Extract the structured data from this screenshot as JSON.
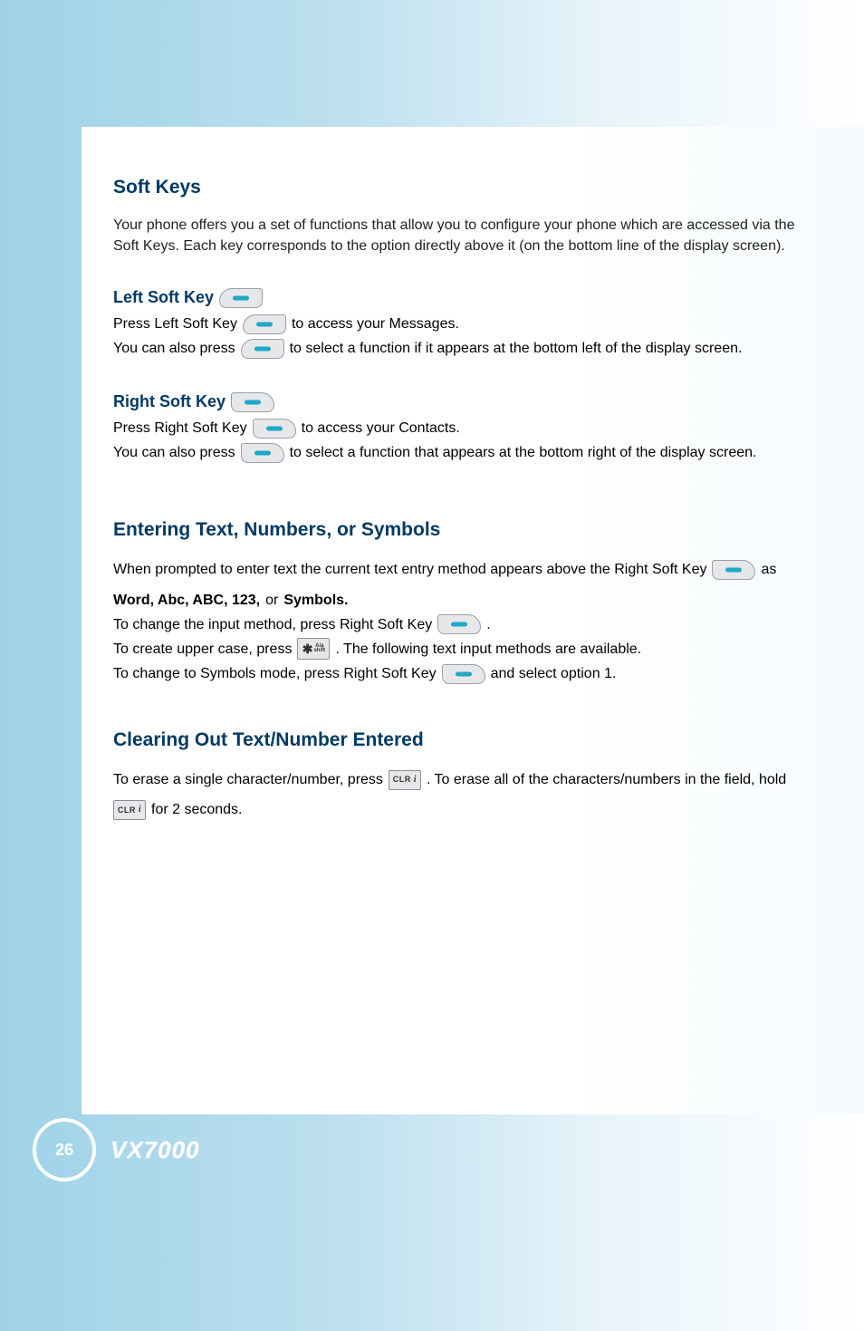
{
  "softkeys": {
    "heading": "Soft Keys",
    "para1": "Your phone offers you a set of functions that allow you to configure your phone which are accessed via the Soft Keys. Each key corresponds to the option directly above it (on the bottom line of the display screen).",
    "left": {
      "title": "Left Soft Key",
      "line1_a": "Press Left Soft Key",
      "line1_b": "to access your Messages.",
      "line2_a": "You can also press",
      "line2_b": "to select a function if it appears at the bottom left of the display screen."
    },
    "right": {
      "title": "Right Soft Key",
      "line1_a": "Press Right Soft Key",
      "line1_b": "to access your Contacts.",
      "line2_a": "You can also press",
      "line2_b": "to select a function that appears at the bottom right of the display screen."
    }
  },
  "entering": {
    "heading": "Entering Text, Numbers, or Symbols",
    "line1": "When prompted to enter text the current text entry method appears above the Right Soft Key",
    "line1_b": "as",
    "modes": "Word, Abc, ABC, 123,",
    "or": "or",
    "symbols": "Symbols.",
    "line2_a": "To change the input method, press Right Soft Key",
    "line2_b": ".",
    "line3_a": "To create upper case, press",
    "line3_b": ". The following text input methods are available.",
    "line4_a": "To change to Symbols mode, press Right Soft Key",
    "line4_b": "and select option 1."
  },
  "clearing": {
    "heading": "Clearing Out Text/Number Entered",
    "line1_a": "To erase a single character/number, press",
    "line1_b": ". To erase all of the characters/numbers in the field, hold",
    "line1_c": "for 2 seconds."
  },
  "footer": {
    "page": "26",
    "model": "VX7000"
  }
}
